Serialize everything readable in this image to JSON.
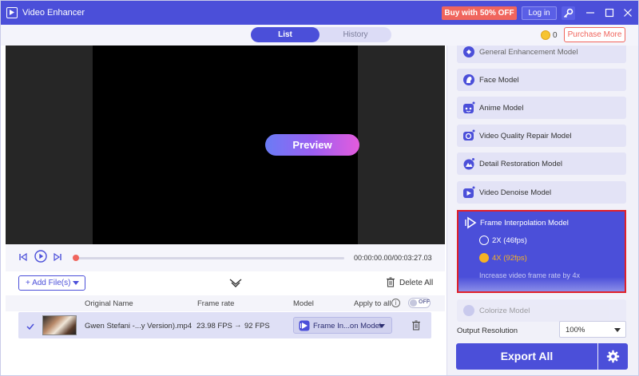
{
  "app": {
    "title": "Video Enhancer",
    "buy_label": "Buy with 50% OFF",
    "login_label": "Log in"
  },
  "tabs": [
    {
      "label": "List",
      "active": true
    },
    {
      "label": "History",
      "active": false
    }
  ],
  "account": {
    "coins": "0",
    "purchase_label": "Purchase More"
  },
  "player": {
    "preview_label": "Preview",
    "timecode": "00:00:00.00/00:03:27.03",
    "progress": 0.0
  },
  "files_toolbar": {
    "add_files_label": "+ Add File(s)",
    "delete_all_label": "Delete All"
  },
  "file_list": {
    "columns": {
      "name": "Original Name",
      "frame_rate": "Frame rate",
      "model": "Model",
      "apply_to_all": "Apply to all"
    },
    "apply_to_all_toggle": "OFF",
    "rows": [
      {
        "name": "Gwen Stefani -...y Version).mp4",
        "fps_in": "23.98 FPS",
        "arrow": "→",
        "fps_out": "92 FPS",
        "model": "Frame In...on Model",
        "checked": true
      }
    ]
  },
  "models": [
    {
      "label": "General Enhancement Model",
      "icon": "general-enhance-icon"
    },
    {
      "label": "Face Model",
      "icon": "face-icon"
    },
    {
      "label": "Anime Model",
      "icon": "anime-icon"
    },
    {
      "label": "Video Quality Repair Model",
      "icon": "quality-repair-icon"
    },
    {
      "label": "Detail Restoration Model",
      "icon": "detail-restore-icon"
    },
    {
      "label": "Video Denoise Model",
      "icon": "denoise-icon"
    }
  ],
  "selected_model": {
    "label": "Frame Interpolation Model",
    "options": [
      {
        "label": "2X (46fps)",
        "selected": false
      },
      {
        "label": "4X (92fps)",
        "selected": true
      }
    ],
    "description": "Increase video frame rate by 4x"
  },
  "colorize_model": {
    "label": "Colorize Model"
  },
  "output": {
    "label": "Output Resolution",
    "resolution": "100%"
  },
  "export": {
    "label": "Export All"
  },
  "colors": {
    "accent": "#4b4fd9",
    "promo": "#f0655d",
    "highlight": "#f5b224",
    "selection_border": "#e0202a"
  }
}
